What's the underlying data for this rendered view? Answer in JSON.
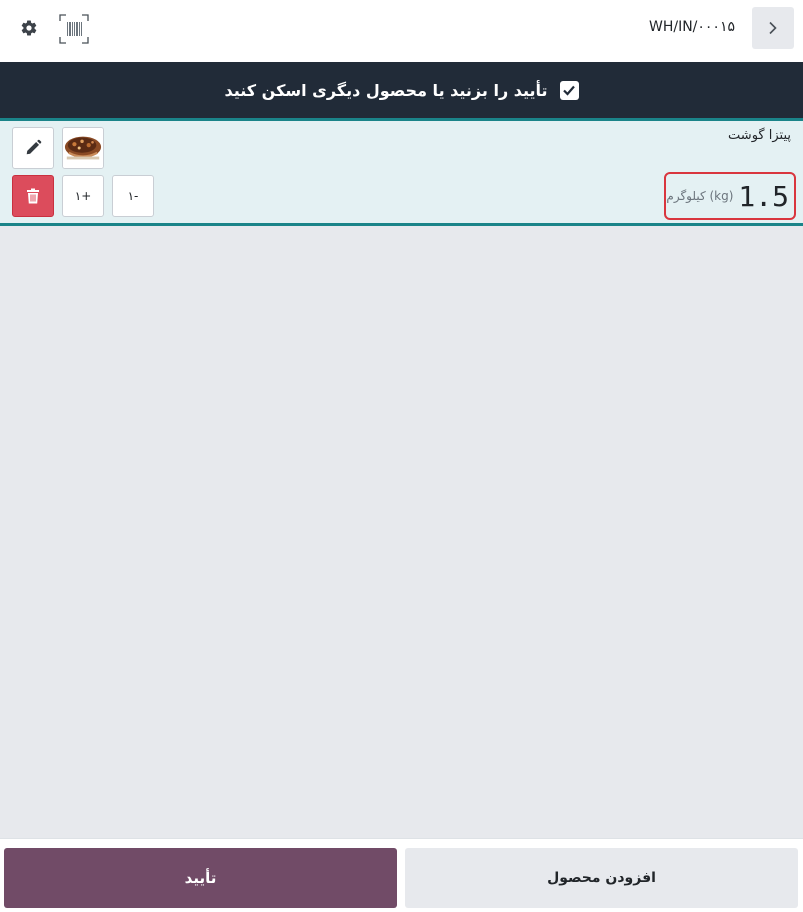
{
  "header": {
    "title": "WH/IN/۰۰۰۱۵",
    "settings_icon": "gear-icon",
    "barcode_icon": "barcode-scan-icon",
    "back_icon": "chevron-right-icon"
  },
  "banner": {
    "text": "تأیید را بزنید یا محصول دیگری اسکن کنید",
    "checked": true
  },
  "line": {
    "product_name": "پیتزا گوشت",
    "quantity": "1.5",
    "uom": "کیلوگرم (kg)",
    "plus_label": "۱+",
    "minus_label": "۱-",
    "edit_icon": "pencil-icon",
    "delete_icon": "trash-icon",
    "image": "product-pizza-image"
  },
  "footer": {
    "confirm_label": "تأیید",
    "add_product_label": "افزودن محصول"
  },
  "colors": {
    "banner_bg": "#212b38",
    "accent": "#714b67",
    "line_border": "#1a8489",
    "highlight": "#d9363e",
    "delete": "#dc4c5c"
  }
}
